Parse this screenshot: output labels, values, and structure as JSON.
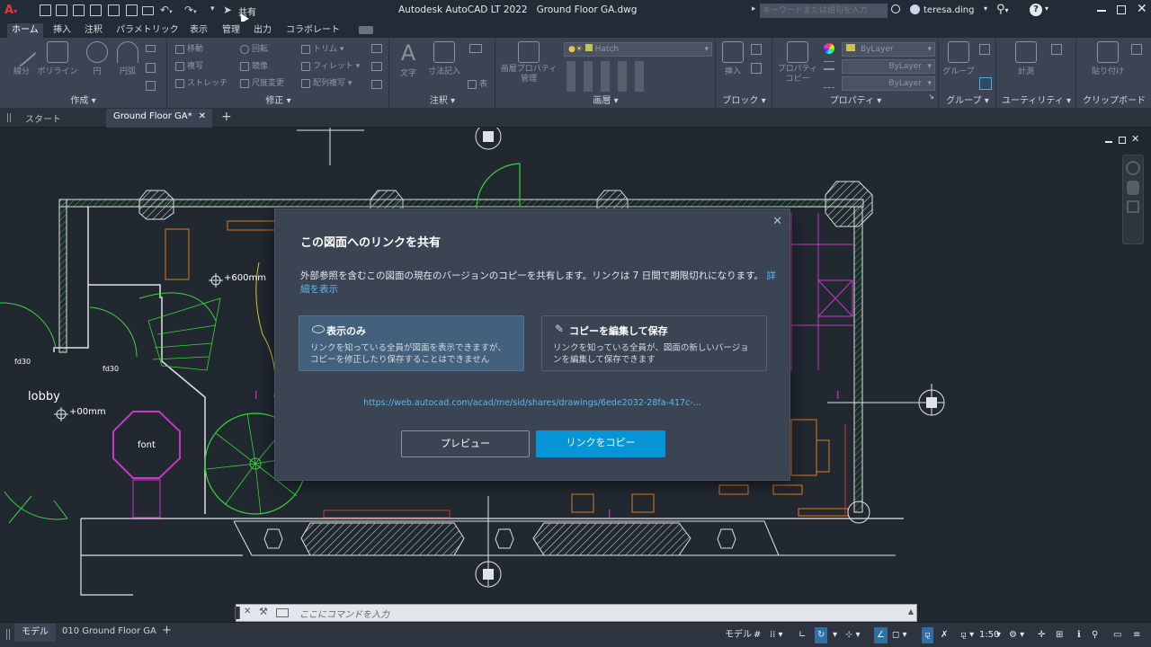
{
  "app": {
    "title": "Autodesk AutoCAD LT 2022",
    "filename": "Ground Floor  GA.dwg",
    "share_label": "共有",
    "search_placeholder": "キーワードまたは語句を入力",
    "user": "teresa.ding"
  },
  "ribbon_tabs": [
    "ホーム",
    "挿入",
    "注釈",
    "パラメトリック",
    "表示",
    "管理",
    "出力",
    "コラボレート"
  ],
  "ribbon": {
    "draw": {
      "title": "作成",
      "line": "線分",
      "polyline": "ポリライン",
      "circle": "円",
      "arc": "円弧"
    },
    "modify": {
      "title": "修正",
      "move": "移動",
      "rotate": "回転",
      "trim": "トリム",
      "copy": "複写",
      "mirror": "鏡像",
      "fillet": "フィレット",
      "stretch": "ストレッチ",
      "scale": "尺度変更",
      "array": "配列複写"
    },
    "annotation": {
      "title": "注釈",
      "text": "文字",
      "dimension": "寸法記入",
      "table": "表"
    },
    "layers": {
      "title": "画層",
      "properties": "画層プロパティ管理",
      "current": "Hatch"
    },
    "block": {
      "title": "ブロック",
      "insert": "挿入"
    },
    "properties": {
      "title": "プロパティ",
      "match": "プロパティコピー",
      "color": "ByLayer",
      "lineweight": "ByLayer",
      "linetype": "ByLayer"
    },
    "groups": {
      "title": "グループ",
      "group": "グループ"
    },
    "utilities": {
      "title": "ユーティリティ",
      "measure": "計測"
    },
    "clipboard": {
      "title": "クリップボード",
      "paste": "貼り付け"
    }
  },
  "doc_tabs": {
    "start": "スタート",
    "active": "Ground Floor  GA*"
  },
  "drawing": {
    "lobby": "lobby",
    "font": "font",
    "elev1": "+600mm",
    "elev2": "+00mm",
    "fd1": "fd30",
    "fd2": "fd30"
  },
  "dialog": {
    "title": "この図面へのリンクを共有",
    "body": "外部参照を含むこの図面の現在のバージョンのコピーを共有します。リンクは 7 日間で期限切れになります。",
    "learn_more": "詳細を表示",
    "view_only_title": "表示のみ",
    "view_only_desc": "リンクを知っている全員が図面を表示できますが、コピーを修正したり保存することはできません",
    "edit_title": "コピーを編集して保存",
    "edit_desc": "リンクを知っている全員が、図面の新しいバージョンを編集して保存できます",
    "url": "https://web.autocad.com/acad/me/sid/shares/drawings/6ede2032-28fa-417c-...",
    "preview_button": "プレビュー",
    "copy_button": "リンクをコピー"
  },
  "command": {
    "placeholder": "ここにコマンドを入力"
  },
  "status": {
    "model_tab": "モデル",
    "layout_tab": "010 Ground Floor GA",
    "model": "モデル",
    "scale": "1:50"
  },
  "colors": {
    "accent": "#0696d7",
    "bg": "#212830",
    "ribbon": "#3b4453",
    "wall_green": "#36d63a",
    "magenta": "#c837c8",
    "orange": "#e07a1e"
  }
}
